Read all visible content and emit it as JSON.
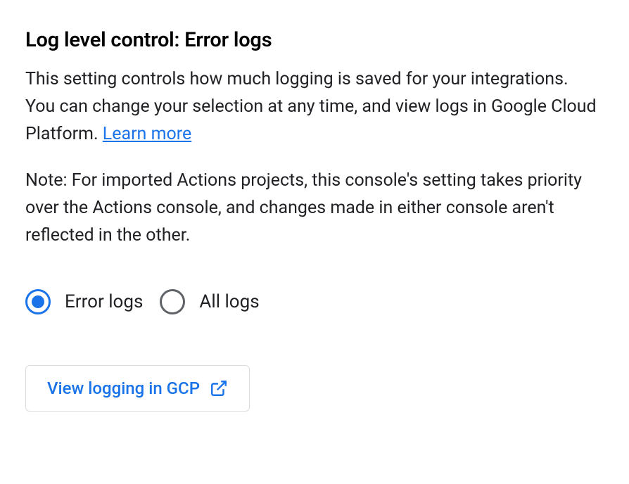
{
  "heading": "Log level control: Error logs",
  "description_part1": "This setting controls how much logging is saved for your integrations. You can change your selection at any time, and view logs in Google Cloud Platform. ",
  "learn_more_label": "Learn more",
  "note": "Note: For imported Actions projects, this console's setting takes priority over the Actions console, and changes made in either console aren't reflected in the other.",
  "radio": {
    "selected": "error",
    "options": {
      "error": "Error logs",
      "all": "All logs"
    }
  },
  "view_button_label": "View logging in GCP"
}
